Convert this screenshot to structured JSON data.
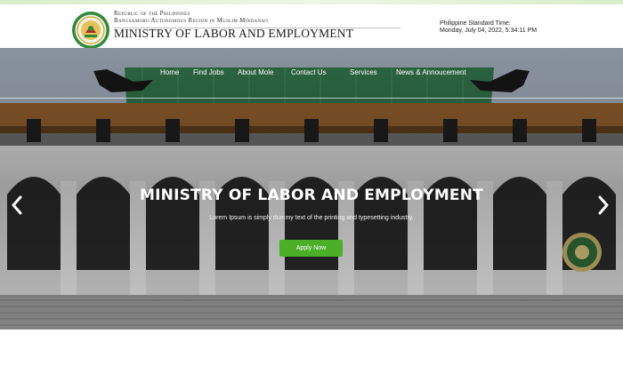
{
  "header": {
    "republic_line": "Republic of the Philippines",
    "region_line": "Bangsamoro Autonomous Region in Muslim Mindanao",
    "org_name": "MINISTRY OF LABOR AND EMPLOYMENT",
    "time_label": "Philippine Standard Time:",
    "time_value": "Monday, July 04, 2022, 5:34:11 PM",
    "seal_icon": "ministry-seal-icon"
  },
  "nav": {
    "items": [
      {
        "label": "Home"
      },
      {
        "label": "Find Jobs"
      },
      {
        "label": "About Mole"
      },
      {
        "label": "Contact Us"
      },
      {
        "label": "Services"
      },
      {
        "label": "News & Annoucement"
      }
    ]
  },
  "hero": {
    "title": "MINISTRY OF LABOR AND EMPLOYMENT",
    "subtitle": "Lorem Ipsum is simply dummy text of the printing and typesetting industry.",
    "cta_label": "Apply Now",
    "prev_icon": "chevron-left-icon",
    "next_icon": "chevron-right-icon"
  },
  "colors": {
    "cta": "#4caf28",
    "top_bar": "#d9ecc9",
    "roof": "#2e6b44"
  }
}
